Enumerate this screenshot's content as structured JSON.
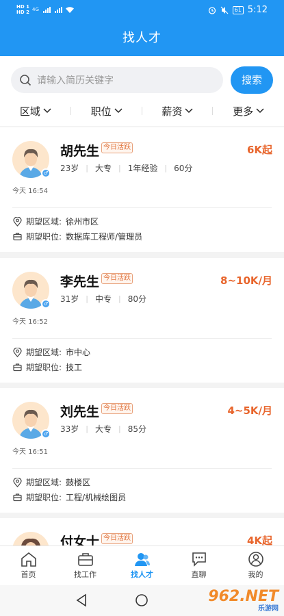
{
  "status_bar": {
    "time": "5:12",
    "battery": "61",
    "network": "4G"
  },
  "title": "找人才",
  "search": {
    "placeholder": "请输入简历关键字",
    "button": "搜索"
  },
  "filters": [
    "区域",
    "职位",
    "薪资",
    "更多"
  ],
  "candidates": [
    {
      "name": "胡先生",
      "tag": "今日活跃",
      "salary": "6K起",
      "time": "今天 16:54",
      "meta": [
        "23岁",
        "大专",
        "1年经验",
        "60分"
      ],
      "area_label": "期望区域:",
      "area": "徐州市区",
      "job_label": "期望职位:",
      "job": "数据库工程师/管理员"
    },
    {
      "name": "李先生",
      "tag": "今日活跃",
      "salary": "8~10K/月",
      "time": "今天 16:52",
      "meta": [
        "31岁",
        "中专",
        "80分"
      ],
      "area_label": "期望区域:",
      "area": "市中心",
      "job_label": "期望职位:",
      "job": "技工"
    },
    {
      "name": "刘先生",
      "tag": "今日活跃",
      "salary": "4~5K/月",
      "time": "今天 16:51",
      "meta": [
        "33岁",
        "大专",
        "85分"
      ],
      "area_label": "期望区域:",
      "area": "鼓楼区",
      "job_label": "期望职位:",
      "job": "工程/机械绘图员"
    },
    {
      "name": "付女士",
      "tag": "今日活跃",
      "salary": "4K起"
    }
  ],
  "tabs": [
    "首页",
    "找工作",
    "找人才",
    "直聊",
    "我的"
  ],
  "active_tab": "找人才",
  "watermark": {
    "main": "962.NET",
    "sub": "乐游网"
  },
  "colors": {
    "primary": "#2196f3",
    "salary": "#e8652c",
    "tag": "#e0733d"
  }
}
